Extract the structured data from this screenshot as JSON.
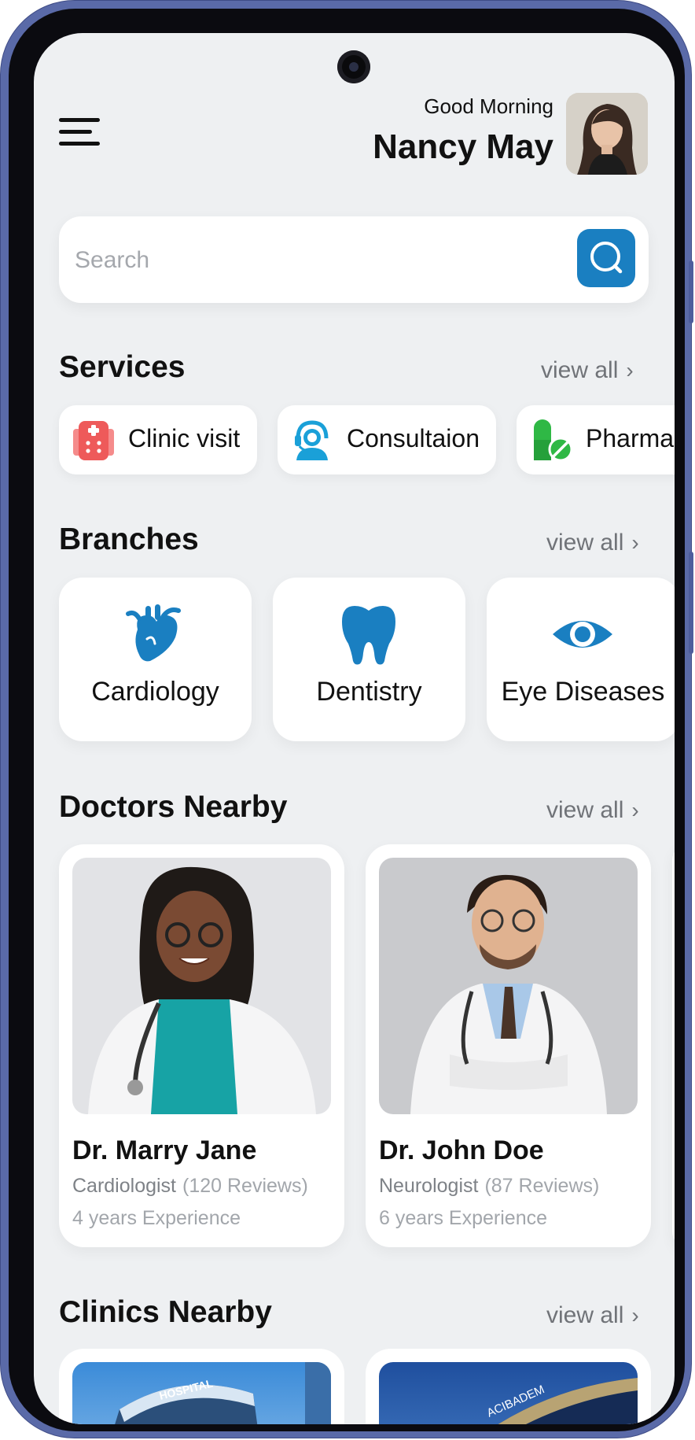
{
  "header": {
    "greeting": "Good Morning",
    "user_name": "Nancy May"
  },
  "search": {
    "placeholder": "Search"
  },
  "services": {
    "title": "Services",
    "view_all": "view all",
    "items": [
      {
        "label": "Clinic visit",
        "icon": "hospital-icon",
        "color": "#f06060"
      },
      {
        "label": "Consultaion",
        "icon": "headset-support-icon",
        "color": "#1aa0d8"
      },
      {
        "label": "Pharmacy",
        "icon": "pills-icon",
        "color": "#2fb845"
      }
    ]
  },
  "branches": {
    "title": "Branches",
    "view_all": "view all",
    "items": [
      {
        "label": "Cardiology",
        "icon": "heart-icon"
      },
      {
        "label": "Dentistry",
        "icon": "tooth-icon"
      },
      {
        "label": "Eye Diseases",
        "icon": "eye-icon"
      }
    ]
  },
  "doctors": {
    "title": "Doctors Nearby",
    "view_all": "view all",
    "items": [
      {
        "name": "Dr. Marry Jane",
        "specialty": "Cardiologist",
        "reviews": "(120 Reviews)",
        "experience": "4 years Experience"
      },
      {
        "name": "Dr. John Doe",
        "specialty": "Neurologist",
        "reviews": "(87 Reviews)",
        "experience": "6 years Experience"
      }
    ]
  },
  "clinics": {
    "title": "Clinics Nearby",
    "view_all": "view all",
    "items": [
      {
        "sign": "HOSPITAL"
      },
      {
        "sign": "ACIBADEM"
      }
    ]
  },
  "colors": {
    "accent": "#1a7fc1",
    "branch_icon": "#1a7fc1",
    "background": "#eef0f2"
  }
}
